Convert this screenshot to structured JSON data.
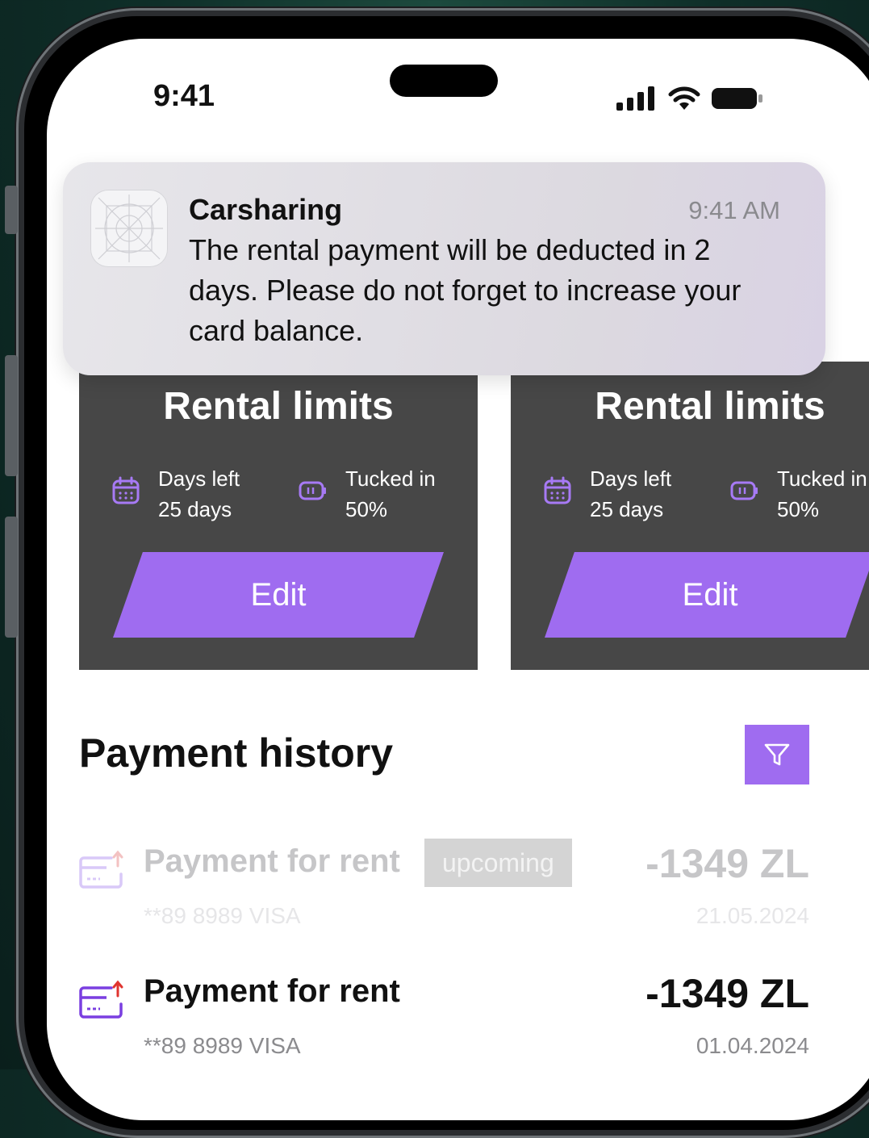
{
  "status_bar": {
    "time": "9:41"
  },
  "notification": {
    "app_name": "Carsharing",
    "time": "9:41 AM",
    "message": "The rental payment will be deducted in 2 days. Please do not forget to increase your card balance."
  },
  "rental_cards": [
    {
      "title": "Rental limits",
      "days_label": "Days left",
      "days_value": "25 days",
      "tucked_label": "Tucked in",
      "tucked_value": "50%",
      "button_label": "Edit"
    },
    {
      "title": "Rental limits",
      "days_label": "Days left",
      "days_value": "25 days",
      "tucked_label": "Tucked in",
      "tucked_value": "50%",
      "button_label": "Edit"
    }
  ],
  "payment_history": {
    "title": "Payment history",
    "items": [
      {
        "title": "Payment for rent",
        "badge": "upcoming",
        "card": "**89 8989 VISA",
        "amount": "-1349 ZL",
        "date": "21.05.2024"
      },
      {
        "title": "Payment for rent",
        "card": "**89 8989 VISA",
        "amount": "-1349 ZL",
        "date": "01.04.2024"
      }
    ]
  },
  "colors": {
    "accent": "#9f6cf0",
    "card_bg": "#474747",
    "page_bg": "#0f2f29"
  },
  "icons": [
    "signal-icon",
    "wifi-icon",
    "battery-icon",
    "calendar-icon",
    "battery-charge-icon",
    "filter-icon",
    "card-outgoing-icon"
  ]
}
